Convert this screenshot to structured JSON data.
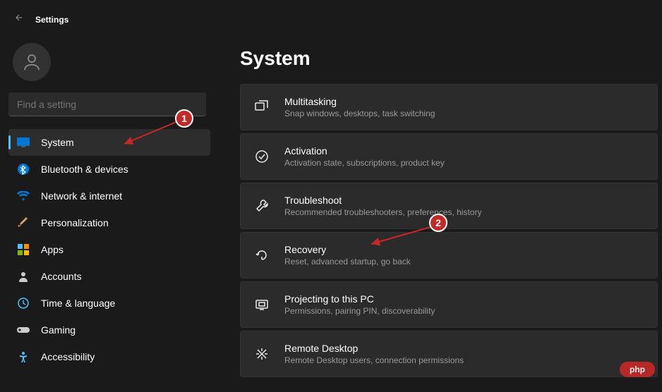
{
  "header": {
    "title": "Settings"
  },
  "search": {
    "placeholder": "Find a setting"
  },
  "page": {
    "title": "System"
  },
  "nav": [
    {
      "id": "system",
      "label": "System",
      "active": true
    },
    {
      "id": "bluetooth",
      "label": "Bluetooth & devices"
    },
    {
      "id": "network",
      "label": "Network & internet"
    },
    {
      "id": "personalization",
      "label": "Personalization"
    },
    {
      "id": "apps",
      "label": "Apps"
    },
    {
      "id": "accounts",
      "label": "Accounts"
    },
    {
      "id": "time",
      "label": "Time & language"
    },
    {
      "id": "gaming",
      "label": "Gaming"
    },
    {
      "id": "accessibility",
      "label": "Accessibility"
    }
  ],
  "cards": [
    {
      "id": "multitasking",
      "title": "Multitasking",
      "subtitle": "Snap windows, desktops, task switching"
    },
    {
      "id": "activation",
      "title": "Activation",
      "subtitle": "Activation state, subscriptions, product key"
    },
    {
      "id": "troubleshoot",
      "title": "Troubleshoot",
      "subtitle": "Recommended troubleshooters, preferences, history"
    },
    {
      "id": "recovery",
      "title": "Recovery",
      "subtitle": "Reset, advanced startup, go back"
    },
    {
      "id": "projecting",
      "title": "Projecting to this PC",
      "subtitle": "Permissions, pairing PIN, discoverability"
    },
    {
      "id": "remote-desktop",
      "title": "Remote Desktop",
      "subtitle": "Remote Desktop users, connection permissions"
    }
  ],
  "annotations": {
    "one": "1",
    "two": "2"
  },
  "watermark": "php"
}
